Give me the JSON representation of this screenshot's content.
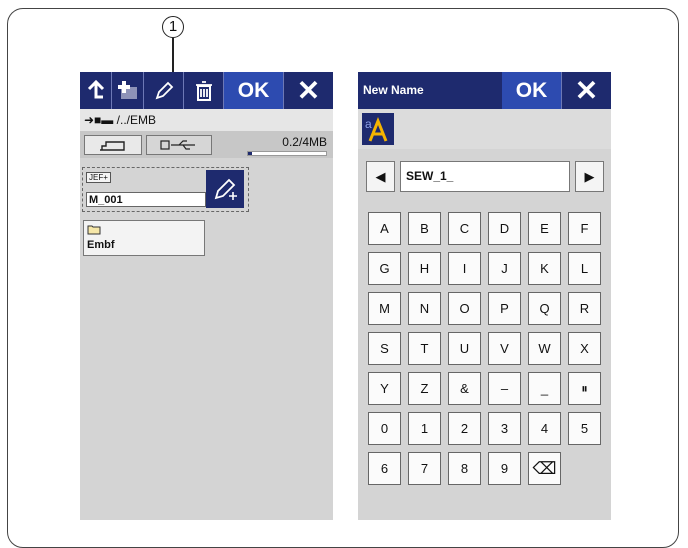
{
  "callout": {
    "label": "1"
  },
  "left_screen": {
    "toolbar": {
      "ok_label": "OK",
      "close_label": "✕"
    },
    "path": "/../EMB",
    "storage": {
      "used_label": "0.2/4MB",
      "used_fraction": 0.05
    },
    "file": {
      "type_badge": "JEF+",
      "name": "M_001"
    },
    "folder": {
      "name": "Embf"
    }
  },
  "right_screen": {
    "title": "New Name",
    "toolbar": {
      "ok_label": "OK",
      "close_label": "✕"
    },
    "name_field": "SEW_1_",
    "keys": [
      [
        "A",
        "B",
        "C",
        "D",
        "E",
        "F"
      ],
      [
        "G",
        "H",
        "I",
        "J",
        "K",
        "L"
      ],
      [
        "M",
        "N",
        "O",
        "P",
        "Q",
        "R"
      ],
      [
        "S",
        "T",
        "U",
        "V",
        "W",
        "X"
      ],
      [
        "Y",
        "Z",
        "&",
        "–",
        "_",
        "⏸"
      ],
      [
        "0",
        "1",
        "2",
        "3",
        "4",
        "5"
      ],
      [
        "6",
        "7",
        "8",
        "9",
        "⌫",
        ""
      ]
    ]
  },
  "colors": {
    "accent": "#1e2a6e",
    "screen_bg": "#d4d4d4"
  }
}
